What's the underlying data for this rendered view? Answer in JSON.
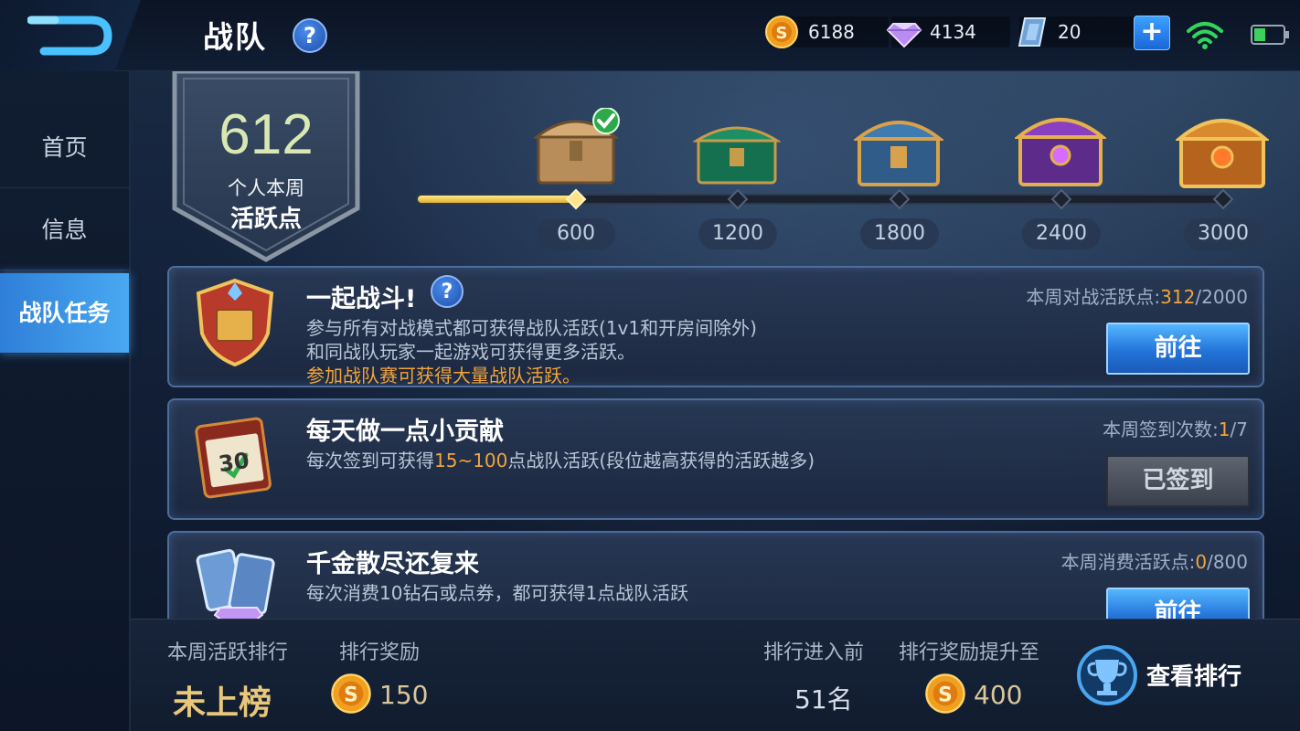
{
  "header": {
    "title": "战队",
    "help_symbol": "?",
    "currencies": [
      {
        "icon": "gold-coin-icon",
        "value": "6188"
      },
      {
        "icon": "diamond-icon",
        "value": "4134"
      },
      {
        "icon": "coupon-icon",
        "value": "20"
      }
    ],
    "add_symbol": "+"
  },
  "sidebar": {
    "items": [
      {
        "label": "首页",
        "active": false
      },
      {
        "label": "信息",
        "active": false
      },
      {
        "label": "战队任务",
        "active": true
      }
    ]
  },
  "activity": {
    "points": "612",
    "label_line1": "个人本周",
    "label_line2": "活跃点",
    "progress_fraction": 0.204,
    "milestones": [
      {
        "value": "600",
        "chest": "wooden-chest-icon",
        "claimed": true
      },
      {
        "value": "1200",
        "chest": "green-chest-icon",
        "claimed": false
      },
      {
        "value": "1800",
        "chest": "blue-chest-icon",
        "claimed": false
      },
      {
        "value": "2400",
        "chest": "purple-chest-icon",
        "claimed": false
      },
      {
        "value": "3000",
        "chest": "golden-chest-icon",
        "claimed": false
      }
    ]
  },
  "tasks": [
    {
      "title": "一起战斗!",
      "line1": "参与所有对战模式都可获得战队活跃(1v1和开房间除外)",
      "line2": "和同战队玩家一起游戏可获得更多活跃。",
      "line3": "参加战队赛可获得大量战队活跃。",
      "stat_label": "本周对战活跃点:",
      "stat_current": "312",
      "stat_total": "/2000",
      "button": "前往"
    },
    {
      "title": "每天做一点小贡献",
      "line1_a": "每次签到可获得",
      "line1_b": "15~100",
      "line1_c": "点战队活跃(段位越高获得的活跃越多)",
      "stat_label": "本周签到次数:",
      "stat_current": "1",
      "stat_total": "/7",
      "button": "已签到",
      "calendar_day": "30"
    },
    {
      "title": "千金散尽还复来",
      "line1": "每次消费10钻石或点券，都可获得1点战队活跃",
      "stat_label": "本周消费活跃点:",
      "stat_current": "0",
      "stat_total": "/800",
      "button": "前往"
    }
  ],
  "footer": {
    "rank_label": "本周活跃排行",
    "rank_value": "未上榜",
    "reward_label": "排行奖励",
    "reward_value": "150",
    "enter_label": "排行进入前",
    "enter_value": "51名",
    "upgrade_label": "排行奖励提升至",
    "upgrade_value": "400",
    "view_button": "查看排行"
  },
  "colors": {
    "accent_blue": "#2f7fd8",
    "highlight_orange": "#f2a53a",
    "progress_gold": "#e0b030"
  }
}
